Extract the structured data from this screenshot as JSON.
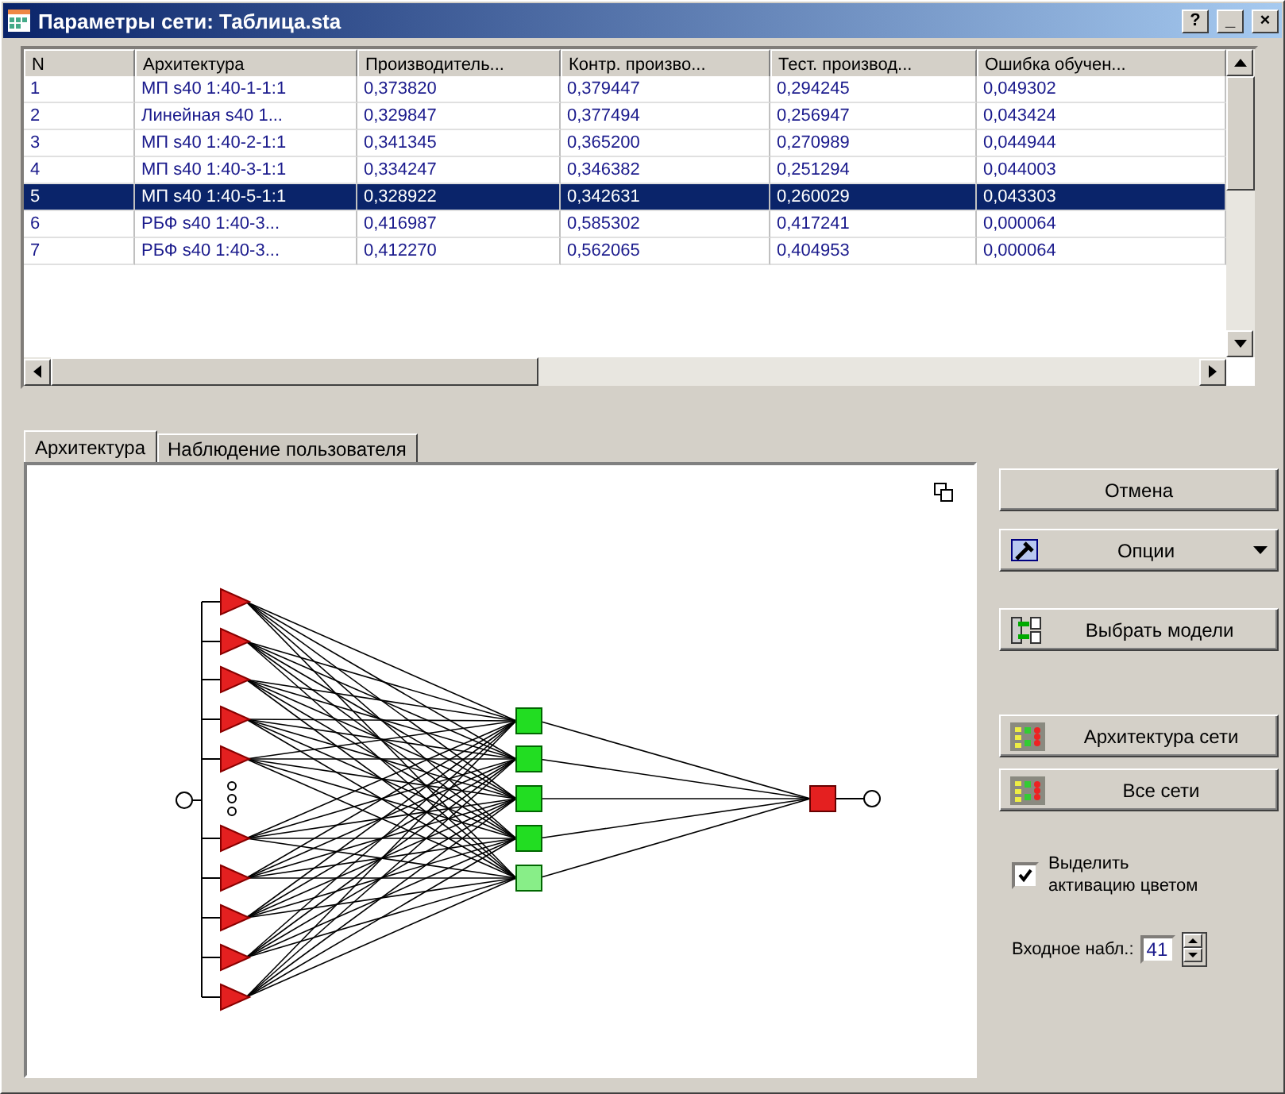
{
  "window": {
    "title": "Параметры сети: Таблица.sta",
    "buttons": [
      "?",
      "_",
      "×"
    ]
  },
  "table": {
    "columns": [
      "N",
      "Архитектура",
      "Производитель...",
      "Контр. произво...",
      "Тест. производ...",
      "Ошибка обучен..."
    ],
    "rows": [
      {
        "cells": [
          "1",
          "МП s40 1:40-1-1:1",
          "0,373820",
          "0,379447",
          "0,294245",
          "0,049302"
        ],
        "selected": false
      },
      {
        "cells": [
          "2",
          "Линейная s40 1...",
          "0,329847",
          "0,377494",
          "0,256947",
          "0,043424"
        ],
        "selected": false
      },
      {
        "cells": [
          "3",
          "МП s40 1:40-2-1:1",
          "0,341345",
          "0,365200",
          "0,270989",
          "0,044944"
        ],
        "selected": false
      },
      {
        "cells": [
          "4",
          "МП s40 1:40-3-1:1",
          "0,334247",
          "0,346382",
          "0,251294",
          "0,044003"
        ],
        "selected": false
      },
      {
        "cells": [
          "5",
          "МП s40 1:40-5-1:1",
          "0,328922",
          "0,342631",
          "0,260029",
          "0,043303"
        ],
        "selected": true
      },
      {
        "cells": [
          "6",
          "РБФ s40 1:40-3...",
          "0,416987",
          "0,585302",
          "0,417241",
          "0,000064"
        ],
        "selected": false
      },
      {
        "cells": [
          "7",
          "РБФ s40 1:40-3...",
          "0,412270",
          "0,562065",
          "0,404953",
          "0,000064"
        ],
        "selected": false
      }
    ]
  },
  "tabs": [
    {
      "label": "Архитектура",
      "selected": true
    },
    {
      "label": "Наблюдение пользователя",
      "selected": false
    }
  ],
  "network": {
    "hidden_units": [
      {
        "color": "#22dd22"
      },
      {
        "color": "#22dd22"
      },
      {
        "color": "#22dd22"
      },
      {
        "color": "#22dd22"
      },
      {
        "color": "#88ee88"
      }
    ]
  },
  "buttons": [
    {
      "label": "Отмена",
      "kind": "plain"
    },
    {
      "label": "Опции",
      "kind": "options"
    },
    {
      "label": "Выбрать модели",
      "kind": "select"
    },
    {
      "label": "Архитектура сети",
      "kind": "network"
    },
    {
      "label": "Все сети",
      "kind": "network"
    }
  ],
  "checkbox": {
    "label": "Выделить активацию цветом",
    "checked": true
  },
  "spinner": {
    "label": "Входное набл.:",
    "value": "41"
  }
}
